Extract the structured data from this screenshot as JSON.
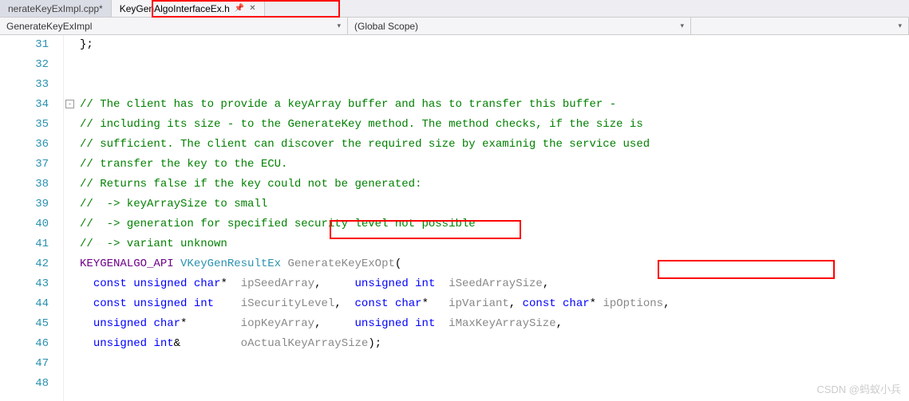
{
  "tabs": [
    {
      "label": "nerateKeyExImpl.cpp*",
      "active": false
    },
    {
      "label": "KeyGenAlgoInterfaceEx.h",
      "active": true
    }
  ],
  "scopes": {
    "s1": "GenerateKeyExImpl",
    "s2": "(Global Scope)",
    "s3": ""
  },
  "line_start": 31,
  "code_lines": [
    [
      {
        "t": "};",
        "c": "c-punct"
      }
    ],
    [],
    [],
    [
      {
        "t": "// The client has to provide a keyArray buffer and has to transfer this buffer -",
        "c": "c-comment"
      }
    ],
    [
      {
        "t": "// including its size - to the GenerateKey method. The method checks, if the size is",
        "c": "c-comment"
      }
    ],
    [
      {
        "t": "// sufficient. The client can discover the required size by examinig the service used",
        "c": "c-comment"
      }
    ],
    [
      {
        "t": "// transfer the key to the ECU.",
        "c": "c-comment"
      }
    ],
    [
      {
        "t": "// Returns false if the key could not be generated:",
        "c": "c-comment"
      }
    ],
    [
      {
        "t": "//  -> keyArraySize to small",
        "c": "c-comment"
      }
    ],
    [
      {
        "t": "//  -> generation for specified security level not possible",
        "c": "c-comment"
      }
    ],
    [
      {
        "t": "//  -> variant unknown",
        "c": "c-comment"
      }
    ],
    [
      {
        "t": "KEYGENALGO_API",
        "c": "c-macro"
      },
      {
        "t": " ",
        "c": ""
      },
      {
        "t": "VKeyGenResultEx",
        "c": "c-type"
      },
      {
        "t": " ",
        "c": ""
      },
      {
        "t": "GenerateKeyExOpt",
        "c": "c-ident"
      },
      {
        "t": "(",
        "c": "c-punct"
      }
    ],
    [
      {
        "t": "  ",
        "c": ""
      },
      {
        "t": "const",
        "c": "c-keyword"
      },
      {
        "t": " ",
        "c": ""
      },
      {
        "t": "unsigned",
        "c": "c-keyword"
      },
      {
        "t": " ",
        "c": ""
      },
      {
        "t": "char",
        "c": "c-keyword"
      },
      {
        "t": "*  ",
        "c": "c-punct"
      },
      {
        "t": "ipSeedArray",
        "c": "c-ident"
      },
      {
        "t": ",     ",
        "c": "c-punct"
      },
      {
        "t": "unsigned",
        "c": "c-keyword"
      },
      {
        "t": " ",
        "c": ""
      },
      {
        "t": "int",
        "c": "c-keyword"
      },
      {
        "t": "  ",
        "c": ""
      },
      {
        "t": "iSeedArraySize",
        "c": "c-ident"
      },
      {
        "t": ",",
        "c": "c-punct"
      }
    ],
    [
      {
        "t": "  ",
        "c": ""
      },
      {
        "t": "const",
        "c": "c-keyword"
      },
      {
        "t": " ",
        "c": ""
      },
      {
        "t": "unsigned",
        "c": "c-keyword"
      },
      {
        "t": " ",
        "c": ""
      },
      {
        "t": "int",
        "c": "c-keyword"
      },
      {
        "t": "    ",
        "c": ""
      },
      {
        "t": "iSecurityLevel",
        "c": "c-ident"
      },
      {
        "t": ",  ",
        "c": "c-punct"
      },
      {
        "t": "const",
        "c": "c-keyword"
      },
      {
        "t": " ",
        "c": ""
      },
      {
        "t": "char",
        "c": "c-keyword"
      },
      {
        "t": "*   ",
        "c": "c-punct"
      },
      {
        "t": "ipVariant",
        "c": "c-ident"
      },
      {
        "t": ", ",
        "c": "c-punct"
      },
      {
        "t": "const",
        "c": "c-keyword"
      },
      {
        "t": " ",
        "c": ""
      },
      {
        "t": "char",
        "c": "c-keyword"
      },
      {
        "t": "* ",
        "c": "c-punct"
      },
      {
        "t": "ipOptions",
        "c": "c-ident"
      },
      {
        "t": ",",
        "c": "c-punct"
      }
    ],
    [
      {
        "t": "  ",
        "c": ""
      },
      {
        "t": "unsigned",
        "c": "c-keyword"
      },
      {
        "t": " ",
        "c": ""
      },
      {
        "t": "char",
        "c": "c-keyword"
      },
      {
        "t": "*        ",
        "c": "c-punct"
      },
      {
        "t": "iopKeyArray",
        "c": "c-ident"
      },
      {
        "t": ",     ",
        "c": "c-punct"
      },
      {
        "t": "unsigned",
        "c": "c-keyword"
      },
      {
        "t": " ",
        "c": ""
      },
      {
        "t": "int",
        "c": "c-keyword"
      },
      {
        "t": "  ",
        "c": ""
      },
      {
        "t": "iMaxKeyArraySize",
        "c": "c-ident"
      },
      {
        "t": ",",
        "c": "c-punct"
      }
    ],
    [
      {
        "t": "  ",
        "c": ""
      },
      {
        "t": "unsigned",
        "c": "c-keyword"
      },
      {
        "t": " ",
        "c": ""
      },
      {
        "t": "int",
        "c": "c-keyword"
      },
      {
        "t": "&         ",
        "c": "c-punct"
      },
      {
        "t": "oActualKeyArraySize",
        "c": "c-ident"
      },
      {
        "t": ");",
        "c": "c-punct"
      }
    ],
    [],
    []
  ],
  "watermark": "CSDN @蚂蚁小兵"
}
